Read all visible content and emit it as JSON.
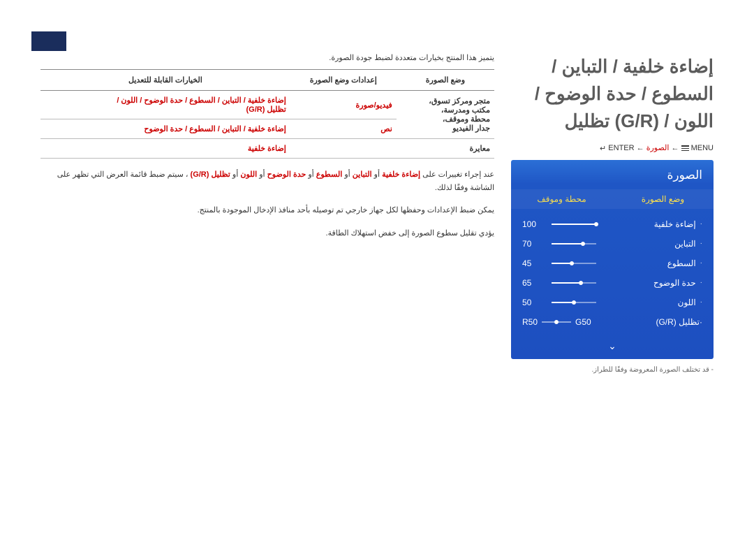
{
  "cornerTab": true,
  "mainTitle": "إضاءة خلفية / التباين / السطوع / حدة الوضوح / اللون / (G/R) تظليل",
  "breadcrumb": {
    "menuWord": "MENU",
    "arrow": "←",
    "picture": "الصورة",
    "enterWord": "ENTER",
    "enterGlyph": "↵"
  },
  "osd": {
    "title": "الصورة",
    "tabs": {
      "active": "وضع الصورة",
      "inactive": "محطة وموقف"
    },
    "rows": [
      {
        "label": "إضاءة خلفية",
        "value": "100",
        "pct": 100
      },
      {
        "label": "التباين",
        "value": "70",
        "pct": 70
      },
      {
        "label": "السطوع",
        "value": "45",
        "pct": 45
      },
      {
        "label": "حدة الوضوح",
        "value": "65",
        "pct": 65
      },
      {
        "label": "اللون",
        "value": "50",
        "pct": 50
      }
    ],
    "tint": {
      "label": "تظليل (G/R)",
      "g": "G50",
      "r": "R50"
    },
    "arrowDown": "⌄"
  },
  "disclaimer": "- قد تختلف الصورة المعروضة وفقًا للطراز.",
  "intro": "يتميز هذا المنتج بخيارات متعددة لضبط جودة الصورة.",
  "table": {
    "headers": {
      "mode": "وضع الصورة",
      "settings": "إعدادات وضع الصورة",
      "options": "الخيارات القابلة للتعديل"
    },
    "rows": [
      {
        "modeTop": "متجر ومركز تسوق",
        "modeBottom": "مكتب ومدرسة",
        "modeExtra": "محطة وموقف",
        "comma": "،",
        "settings": "فيديو/صورة",
        "options": "إضاءة خلفية / التباين / السطوع / حدة الوضوح / اللون /",
        "optionsLine2": "تظليل (G/R)"
      },
      {
        "modeTop": "جدار الفيديو",
        "settings": "نص",
        "options": "إضاءة خلفية / التباين / السطوع / حدة الوضوح"
      },
      {
        "modeTop": "معايرة",
        "settings": "",
        "options": "إضاءة خلفية"
      }
    ]
  },
  "notes": {
    "n1a": "عند إجراء تغييرات على ",
    "n1b": "إضاءة خلفية",
    "n1c": " أو ",
    "n1d": "التباين",
    "n1e": " أو ",
    "n1f": "السطوع",
    "n1g": " أو ",
    "n1h": "حدة الوضوح",
    "n1i": " أو ",
    "n1j": "اللون",
    "n1k": " أو ",
    "n1l": "تظليل (G/R)",
    "n1m": "، سيتم ضبط قائمة العرض التي تظهر على الشاشة وفقًا لذلك.",
    "n2": "يمكن ضبط الإعدادات وحفظها لكل جهاز خارجي تم توصيله بأحد منافذ الإدخال الموجودة بالمنتج.",
    "n3": "يؤدي تقليل سطوع الصورة إلى خفض استهلاك الطاقة."
  }
}
